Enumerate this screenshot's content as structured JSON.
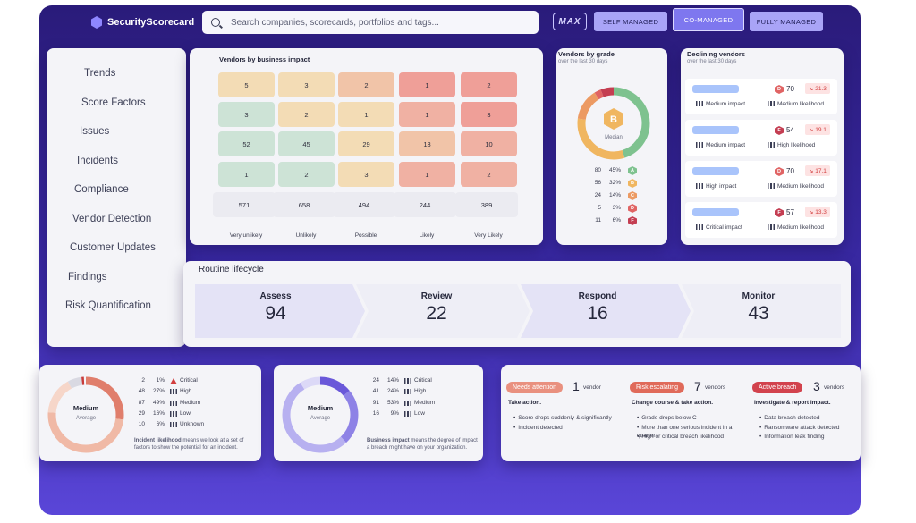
{
  "app": {
    "brand": "SecurityScorecard"
  },
  "search": {
    "placeholder": "Search companies, scorecards, portfolios and tags..."
  },
  "header": {
    "max_label": "MAX",
    "modes": [
      {
        "label": "SELF MANAGED",
        "active": false
      },
      {
        "label": "CO-MANAGED",
        "active": true
      },
      {
        "label": "FULLY MANAGED",
        "active": false
      }
    ]
  },
  "sidebar": {
    "items": [
      {
        "label": "Trends"
      },
      {
        "label": "Score Factors"
      },
      {
        "label": "Issues"
      },
      {
        "label": "Incidents"
      },
      {
        "label": "Compliance"
      },
      {
        "label": "Vendor Detection"
      },
      {
        "label": "Customer Updates"
      },
      {
        "label": "Findings"
      },
      {
        "label": "Risk Quantification"
      }
    ]
  },
  "vendors_by_impact": {
    "title": "Vendors by business impact",
    "rows": [
      [
        "5",
        "3",
        "2",
        "1",
        "2"
      ],
      [
        "3",
        "2",
        "1",
        "1",
        "3"
      ],
      [
        "52",
        "45",
        "29",
        "13",
        "10"
      ],
      [
        "1",
        "2",
        "3",
        "1",
        "2"
      ]
    ],
    "totals": [
      "571",
      "658",
      "494",
      "244",
      "389"
    ],
    "columns": [
      "Very unlikely",
      "Unlikely",
      "Possible",
      "Likely",
      "Very Likely"
    ],
    "colors": {
      "green": "#cde3d6",
      "yellow": "#f3dcb5",
      "orange": "#f1c4a8",
      "red": "#ef9f98",
      "redmid": "#f0b1a3",
      "grey": "#e6e7ee"
    }
  },
  "vendors_by_grade": {
    "title": "Vendors by grade",
    "subtitle": "over the last 30 days",
    "median_grade": "B",
    "median_label": "Median",
    "grades": [
      {
        "count": "80",
        "pct": "45%",
        "grade": "A",
        "color": "#7ec28f"
      },
      {
        "count": "56",
        "pct": "32%",
        "grade": "B",
        "color": "#f0b660"
      },
      {
        "count": "24",
        "pct": "14%",
        "grade": "C",
        "color": "#ec9a63"
      },
      {
        "count": "5",
        "pct": "3%",
        "grade": "D",
        "color": "#e06464"
      },
      {
        "count": "11",
        "pct": "6%",
        "grade": "F",
        "color": "#c43e52"
      }
    ]
  },
  "declining_vendors": {
    "title": "Declining vendors",
    "subtitle": "over the last 30 days",
    "items": [
      {
        "grade": "D",
        "score": "70",
        "change": "↘ 21.3",
        "impact": "Medium impact",
        "likelihood": "Medium likelihood"
      },
      {
        "grade": "F",
        "score": "54",
        "change": "↘ 19.1",
        "impact": "Medium impact",
        "likelihood": "High likelihood"
      },
      {
        "grade": "D",
        "score": "70",
        "change": "↘ 17.1",
        "impact": "High impact",
        "likelihood": "Medium likelihood"
      },
      {
        "grade": "F",
        "score": "57",
        "change": "↘ 13.3",
        "impact": "Critical impact",
        "likelihood": "Medium likelihood"
      }
    ]
  },
  "lifecycle": {
    "title": "Routine lifecycle",
    "phases": [
      {
        "name": "Assess",
        "value": "94"
      },
      {
        "name": "Review",
        "value": "22"
      },
      {
        "name": "Respond",
        "value": "16"
      },
      {
        "name": "Monitor",
        "value": "43"
      }
    ]
  },
  "incident_likelihood": {
    "center": "Medium",
    "center_sub": "Average",
    "rows": [
      {
        "count": "2",
        "pct": "1%",
        "label": "Critical"
      },
      {
        "count": "48",
        "pct": "27%",
        "label": "High"
      },
      {
        "count": "87",
        "pct": "49%",
        "label": "Medium"
      },
      {
        "count": "29",
        "pct": "16%",
        "label": "Low"
      },
      {
        "count": "10",
        "pct": "6%",
        "label": "Unknown"
      }
    ],
    "note_bold": "Incident likelihood",
    "note": "means we look at a set of factors to show the potential for an incident."
  },
  "business_impact": {
    "center": "Medium",
    "center_sub": "Average",
    "rows": [
      {
        "count": "24",
        "pct": "14%",
        "label": "Critical"
      },
      {
        "count": "41",
        "pct": "24%",
        "label": "High"
      },
      {
        "count": "91",
        "pct": "53%",
        "label": "Medium"
      },
      {
        "count": "16",
        "pct": "9%",
        "label": "Low"
      }
    ],
    "note_bold": "Business impact",
    "note": "means the degree of impact a breach might have on your organization."
  },
  "actions": [
    {
      "tag": "Needs attention",
      "tag_color": "#e9907f",
      "count": "1",
      "unit": "vendor",
      "heading": "Take action.",
      "bullets": [
        "Score drops suddenly & significantly",
        "Incident detected"
      ]
    },
    {
      "tag": "Risk escalating",
      "tag_color": "#e06a5a",
      "count": "7",
      "unit": "vendors",
      "heading": "Change course & take action.",
      "bullets": [
        "Grade drops below C",
        "More than one serious incident in a quarter",
        "High or critical breach likelihood"
      ]
    },
    {
      "tag": "Active breach",
      "tag_color": "#d2424d",
      "count": "3",
      "unit": "vendors",
      "heading": "Investigate & report impact.",
      "bullets": [
        "Data breach detected",
        "Ransomware attack detected",
        "Information leak finding"
      ]
    }
  ]
}
